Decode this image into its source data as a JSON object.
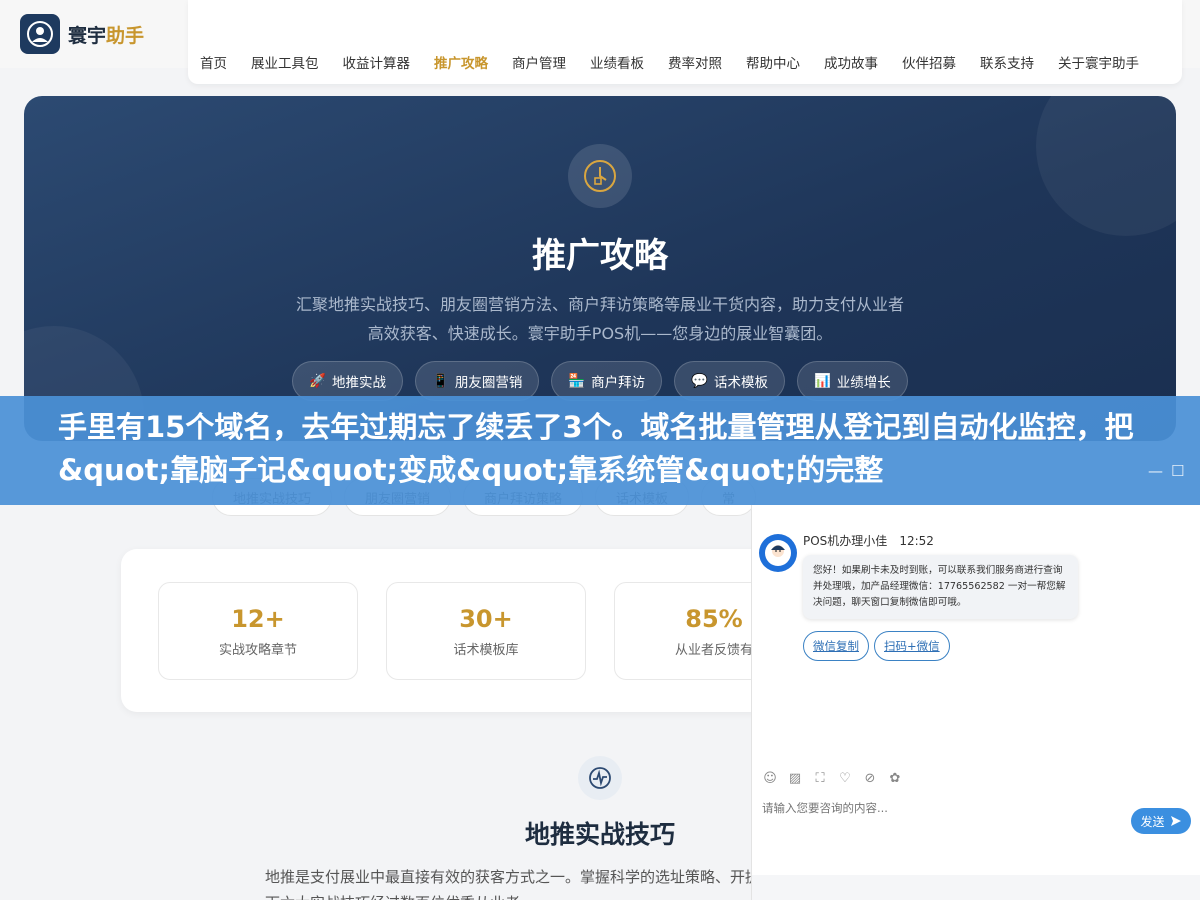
{
  "header": {
    "logo_main": "寰宇",
    "logo_accent": "助手",
    "nav": [
      "首页",
      "展业工具包",
      "收益计算器",
      "推广攻略",
      "商户管理",
      "业绩看板",
      "费率对照",
      "帮助中心",
      "成功故事",
      "伙伴招募",
      "联系支持",
      "关于寰宇助手"
    ],
    "active_index": 3
  },
  "hero": {
    "icon": "clock-icon",
    "title": "推广攻略",
    "desc": "汇聚地推实战技巧、朋友圈营销方法、商户拜访策略等展业干货内容，助力支付从业者高效获客、快速成长。寰宇助手POS机——您身边的展业智囊团。",
    "tags": [
      {
        "icon": "🚀",
        "label": "地推实战"
      },
      {
        "icon": "📱",
        "label": "朋友圈营销"
      },
      {
        "icon": "🏪",
        "label": "商户拜访"
      },
      {
        "icon": "💬",
        "label": "话术模板"
      },
      {
        "icon": "📊",
        "label": "业绩增长"
      }
    ]
  },
  "subnav": [
    "地推实战技巧",
    "朋友圈营销",
    "商户拜访策略",
    "话术模板",
    "常"
  ],
  "stats": [
    {
      "value": "12+",
      "label": "实战攻略章节"
    },
    {
      "value": "30+",
      "label": "话术模板库"
    },
    {
      "value": "85%",
      "label": "从业者反馈有"
    }
  ],
  "section": {
    "icon": "activity-icon",
    "title": "地推实战技巧",
    "desc": "地推是支付展业中最直接有效的获客方式之一。掌握科学的选址策略、开提升顾客功率和商户转化率。以下六大实战技巧经过数百位优秀从业者"
  },
  "banner": {
    "text": "手里有15个域名，去年过期忘了续丢了3个。域名批量管理从登记到自动化监控，把&quot;靠脑子记&quot;变成&quot;靠系统管&quot;的完整",
    "minimize": "—",
    "maximize": "☐"
  },
  "chat": {
    "agent_name": "POS机办理小佳",
    "time": "12:52",
    "message": "您好！如果刷卡未及时到账，可以联系我们服务商进行查询并处理哦，加产品经理微信：17765562582 一对一帮您解决问题，聊天窗口复制微信即可哦。",
    "btn_copy": "微信复制",
    "btn_scan": "扫码+微信",
    "tools": [
      "☺",
      "▨",
      "⛶",
      "♡",
      "⊘",
      "✿"
    ],
    "input_placeholder": "请输入您要咨询的内容...",
    "send": "发送"
  }
}
